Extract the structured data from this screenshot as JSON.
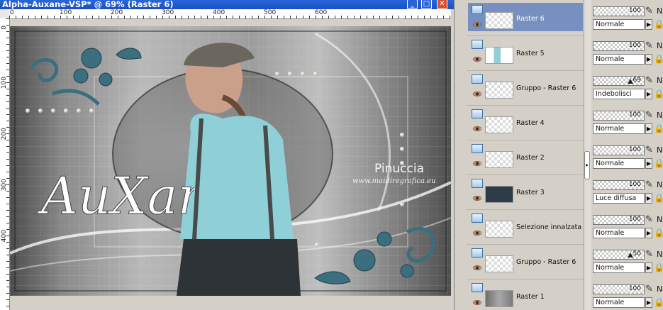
{
  "window": {
    "title": "Alpha-Auxane-VSP* @  69% (Raster 6)",
    "minimize_glyph": "_",
    "maximize_glyph": "□",
    "close_glyph": "✕"
  },
  "ruler": {
    "top_labels": [
      "0",
      "100",
      "200",
      "300",
      "400",
      "500",
      "600"
    ],
    "left_labels": [
      "0",
      "100",
      "200",
      "300",
      "400"
    ]
  },
  "canvas": {
    "logo_text": "AuXane",
    "watermark_name": "Pinuccia",
    "watermark_url": "www.maidiregrafica.eu"
  },
  "layers": [
    {
      "name": "Raster 6",
      "selected": true,
      "thumb": "checker-light"
    },
    {
      "name": "Raster 5",
      "selected": false,
      "thumb": "photo-small"
    },
    {
      "name": "Gruppo - Raster 6",
      "selected": false,
      "thumb": "checker"
    },
    {
      "name": "Raster 4",
      "selected": false,
      "thumb": "checker-ornament"
    },
    {
      "name": "Raster 2",
      "selected": false,
      "thumb": "checker"
    },
    {
      "name": "Raster 3",
      "selected": false,
      "thumb": "dark-frame"
    },
    {
      "name": "Selezione innalzata",
      "selected": false,
      "thumb": "checker-stripe"
    },
    {
      "name": "Gruppo - Raster 6",
      "selected": false,
      "thumb": "checker"
    },
    {
      "name": "Raster 1",
      "selected": false,
      "thumb": "gray-blur"
    }
  ],
  "layer_props": [
    {
      "opacity": "100",
      "blend": "Normale",
      "slider": false
    },
    {
      "opacity": "100",
      "blend": "Normale",
      "slider": false
    },
    {
      "opacity": "69",
      "blend": "Indebolisci",
      "slider": true
    },
    {
      "opacity": "100",
      "blend": "Normale",
      "slider": false
    },
    {
      "opacity": "100",
      "blend": "Normale",
      "slider": false
    },
    {
      "opacity": "100",
      "blend": "Luce diffusa",
      "slider": false
    },
    {
      "opacity": "100",
      "blend": "Normale",
      "slider": false
    },
    {
      "opacity": "50",
      "blend": "Normale",
      "slider": true
    },
    {
      "opacity": "100",
      "blend": "Normale",
      "slider": false
    }
  ],
  "glyphs": {
    "pen": "✎",
    "lock": "🔒",
    "dropdown_arrow": "▶",
    "collapse": "▸",
    "n_letter": "N"
  },
  "colors": {
    "titlebar": "#1a4fc4",
    "selected_layer": "#7890c0",
    "panel_bg": "#d4d0c8",
    "accent_teal": "#3b6e7e"
  }
}
